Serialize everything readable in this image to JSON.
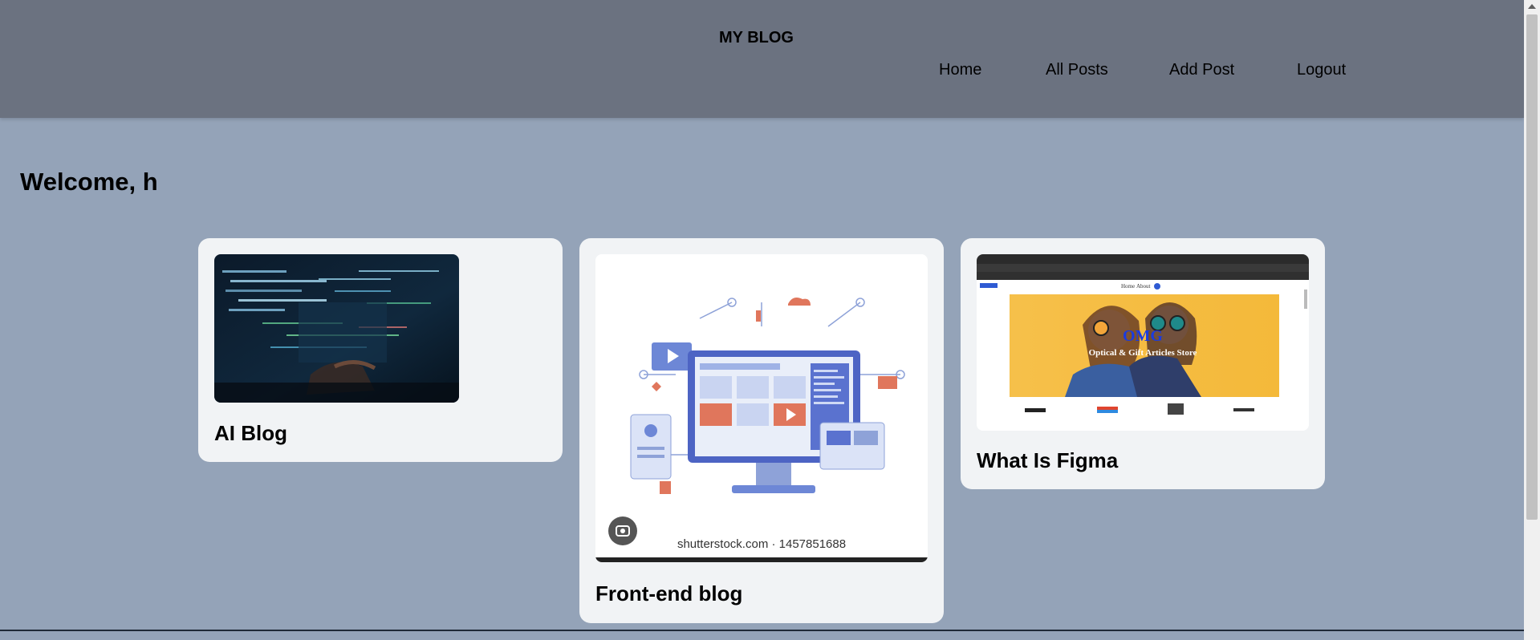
{
  "header": {
    "brand": "MY BLOG",
    "nav": [
      "Home",
      "All Posts",
      "Add Post",
      "Logout"
    ]
  },
  "welcome": "Welcome, h",
  "posts": [
    {
      "title": "AI Blog"
    },
    {
      "title": "Front-end blog",
      "image_caption": "shutterstock.com · 1457851688"
    },
    {
      "title": "What Is Figma",
      "image_text": {
        "brand": "OMG",
        "subtitle": "Optical & Gift Articles Store",
        "nav": [
          "Home",
          "About"
        ]
      }
    }
  ]
}
